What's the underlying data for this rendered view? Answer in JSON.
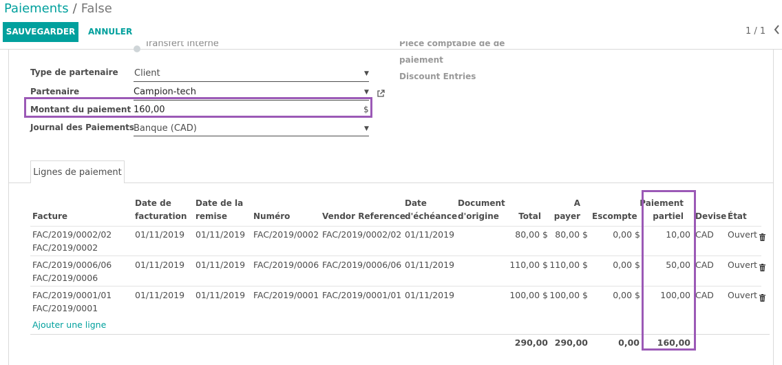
{
  "breadcrumb": {
    "parent": "Paiements",
    "separator": "/",
    "current": "False"
  },
  "toolbar": {
    "save_label": "SAUVEGARDER",
    "cancel_label": "ANNULER"
  },
  "pager": {
    "value": "1 / 1",
    "prev_icon": "chevron-left-icon"
  },
  "form": {
    "partial_top_left": "Transfert interne",
    "partial_top_right": "Pièce comptable de de",
    "partial_right_2": "paiement",
    "discount_entries_label": "Discount Entries",
    "partner_type": {
      "label": "Type de partenaire",
      "value": "Client"
    },
    "partner": {
      "label": "Partenaire",
      "value": "Campion-tech"
    },
    "amount": {
      "label": "Montant du paiement",
      "value": "160,00",
      "currency_symbol": "$"
    },
    "journal": {
      "label": "Journal des Paiements",
      "value": "Banque (CAD)"
    }
  },
  "tabs": [
    {
      "label": "Lignes de paiement",
      "active": true
    }
  ],
  "table": {
    "headers": {
      "invoice": "Facture",
      "invoice_date": [
        "Date de",
        "facturation"
      ],
      "remise_date": [
        "Date de la",
        "remise"
      ],
      "number": "Numéro",
      "vendor_reference": "Vendor Reference",
      "due_date": [
        "Date",
        "d'échéance"
      ],
      "origin": [
        "Document",
        "d'origine"
      ],
      "total": "Total",
      "to_pay": [
        "A",
        "payer"
      ],
      "discount": "Escompte",
      "partial_payment": [
        "Paiement",
        "partiel"
      ],
      "currency": "Devise",
      "state": "État"
    },
    "rows": [
      {
        "invoice_1": "FAC/2019/0002/02",
        "invoice_2": "FAC/2019/0002",
        "invoice_date": "01/11/2019",
        "remise_date": "01/11/2019",
        "number": "FAC/2019/0002",
        "vendor_reference": "FAC/2019/0002/02",
        "due_date": "01/11/2019",
        "total": "80,00 $",
        "to_pay": "80,00 $",
        "discount": "0,00 $",
        "partial": "10,00",
        "currency": "CAD",
        "state": "Ouvert"
      },
      {
        "invoice_1": "FAC/2019/0006/06",
        "invoice_2": "FAC/2019/0006",
        "invoice_date": "01/11/2019",
        "remise_date": "01/11/2019",
        "number": "FAC/2019/0006",
        "vendor_reference": "FAC/2019/0006/06",
        "due_date": "01/11/2019",
        "total": "110,00 $",
        "to_pay": "110,00 $",
        "discount": "0,00 $",
        "partial": "50,00",
        "currency": "CAD",
        "state": "Ouvert"
      },
      {
        "invoice_1": "FAC/2019/0001/01",
        "invoice_2": "FAC/2019/0001",
        "invoice_date": "01/11/2019",
        "remise_date": "01/11/2019",
        "number": "FAC/2019/0001",
        "vendor_reference": "FAC/2019/0001/01",
        "due_date": "01/11/2019",
        "total": "100,00 $",
        "to_pay": "100,00 $",
        "discount": "0,00 $",
        "partial": "100,00",
        "currency": "CAD",
        "state": "Ouvert"
      }
    ],
    "add_line_label": "Ajouter une ligne",
    "totals": {
      "total": "290,00",
      "to_pay": "290,00",
      "discount": "0,00",
      "partial": "160,00"
    }
  },
  "colors": {
    "accent": "#00a09d",
    "highlight": "#9b59b6",
    "text": "#4c4c4c"
  }
}
